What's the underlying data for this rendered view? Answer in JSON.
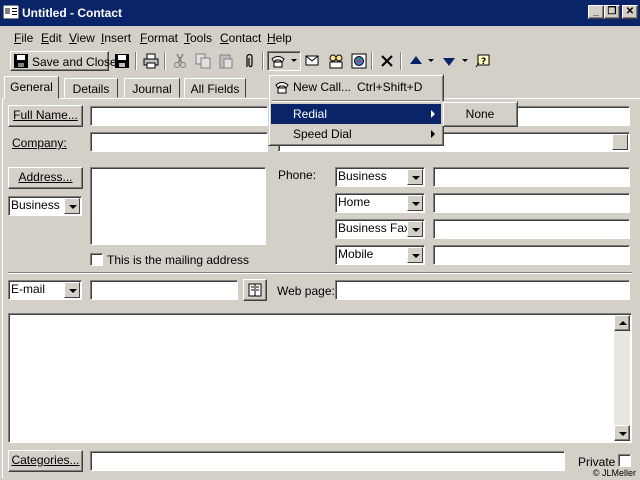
{
  "window": {
    "title": "Untitled - Contact"
  },
  "menu": [
    "File",
    "Edit",
    "View",
    "Insert",
    "Format",
    "Tools",
    "Contact",
    "Help"
  ],
  "toolbar": {
    "save_close": "Save and Close"
  },
  "tabs": [
    "General",
    "Details",
    "Journal",
    "All Fields"
  ],
  "form": {
    "full_name_btn": "Full Name...",
    "company_label": "Company:",
    "address_btn": "Address...",
    "address_type": "Business",
    "mailing_check": "This is the mailing address",
    "phone_label": "Phone:",
    "phones": [
      "Business",
      "Home",
      "Business Fax",
      "Mobile"
    ],
    "email_type": "E-mail",
    "webpage_label": "Web page:",
    "categories_btn": "Categories...",
    "private_label": "Private"
  },
  "dial_menu": {
    "new_call": "New Call...",
    "new_call_shortcut": "Ctrl+Shift+D",
    "redial": "Redial",
    "speed_dial": "Speed Dial"
  },
  "redial_submenu": {
    "none": "None"
  },
  "credit": "© JLMeller"
}
